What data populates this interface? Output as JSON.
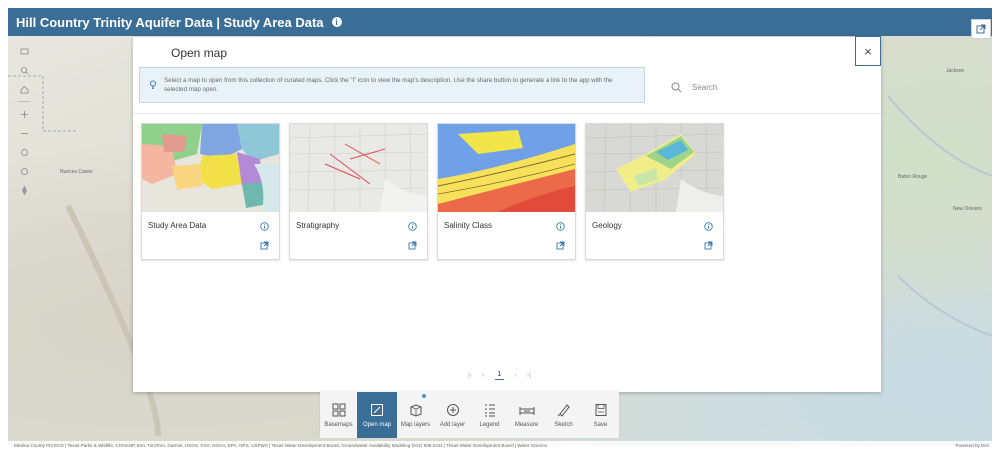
{
  "header": {
    "title": "Hill Country Trinity Aquifer Data | Study Area Data",
    "info_glyph": "i"
  },
  "map_labels": {
    "nueces": "Nueces Cases",
    "jackson": "Jackson",
    "baton_rouge": "Baton Rouge",
    "new_orleans": "New Orleans"
  },
  "modal": {
    "title": "Open map",
    "close_glyph": "×",
    "notice": "Select a map to open from this collection of curated maps. Click the \"i\" icon to view the map's description. Use the share button to generate a link to the app with the selected map open.",
    "search_placeholder": "Search"
  },
  "cards": [
    {
      "title": "Study Area Data",
      "thumb": "study-area"
    },
    {
      "title": "Stratigraphy",
      "thumb": "stratigraphy"
    },
    {
      "title": "Salinity Class",
      "thumb": "salinity"
    },
    {
      "title": "Geology",
      "thumb": "geology"
    }
  ],
  "pagination": {
    "first": "|‹",
    "prev": "‹",
    "current": "1",
    "next": "›",
    "last": "›|"
  },
  "toolbar": [
    {
      "label": "Basemaps",
      "icon": "basemap-grid-icon"
    },
    {
      "label": "Open map",
      "icon": "open-map-icon",
      "active": true
    },
    {
      "label": "Map layers",
      "icon": "layers-icon"
    },
    {
      "label": "Add layer",
      "icon": "add-layer-icon"
    },
    {
      "label": "Legend",
      "icon": "legend-list-icon"
    },
    {
      "label": "Measure",
      "icon": "ruler-icon"
    },
    {
      "label": "Sketch",
      "icon": "pencil-icon"
    },
    {
      "label": "Save",
      "icon": "save-icon"
    }
  ],
  "attribution": {
    "text": "Medina County Pi3 ECD | Texas Parks & Wildlife, CONANP, Esri, TomTom, Garmin, USGS, FAO, NOAA, EPA, NPS, USFWS | Texas Water Development Board, Groundwater Availability Modeling (512) 936-2411 | Texas Water Development Board | Water Science",
    "powered": "Powered by Esri"
  },
  "colors": {
    "header": "#3a6e96",
    "notice_bg": "#e9f2f8",
    "accent": "#3a6e96"
  }
}
